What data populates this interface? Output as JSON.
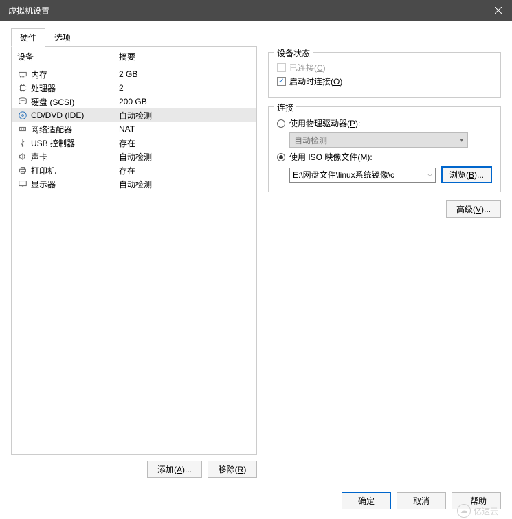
{
  "titlebar": {
    "title": "虚拟机设置"
  },
  "tabs": {
    "hardware": "硬件",
    "options": "选项"
  },
  "columns": {
    "device": "设备",
    "summary": "摘要"
  },
  "devices": [
    {
      "icon": "memory-icon",
      "name": "内存",
      "summary": "2 GB"
    },
    {
      "icon": "cpu-icon",
      "name": "处理器",
      "summary": "2"
    },
    {
      "icon": "disk-icon",
      "name": "硬盘 (SCSI)",
      "summary": "200 GB"
    },
    {
      "icon": "cd-icon",
      "name": "CD/DVD (IDE)",
      "summary": "自动检测"
    },
    {
      "icon": "network-icon",
      "name": "网络适配器",
      "summary": "NAT"
    },
    {
      "icon": "usb-icon",
      "name": "USB 控制器",
      "summary": "存在"
    },
    {
      "icon": "sound-icon",
      "name": "声卡",
      "summary": "自动检测"
    },
    {
      "icon": "printer-icon",
      "name": "打印机",
      "summary": "存在"
    },
    {
      "icon": "display-icon",
      "name": "显示器",
      "summary": "自动检测"
    }
  ],
  "selected_index": 3,
  "buttons": {
    "add": "添加(A)...",
    "remove": "移除(R)",
    "advanced": "高级(V)...",
    "browse": "浏览(B)...",
    "ok": "确定",
    "cancel": "取消",
    "help": "帮助"
  },
  "status_group": {
    "title": "设备状态",
    "connected": "已连接(C)",
    "connect_at_power": "启动时连接(O)"
  },
  "connection_group": {
    "title": "连接",
    "use_physical": "使用物理驱动器(P):",
    "auto_detect": "自动检测",
    "use_iso": "使用 ISO 映像文件(M):",
    "iso_path": "E:\\网盘文件\\linux系统镜像\\c"
  },
  "watermark": "亿速云"
}
